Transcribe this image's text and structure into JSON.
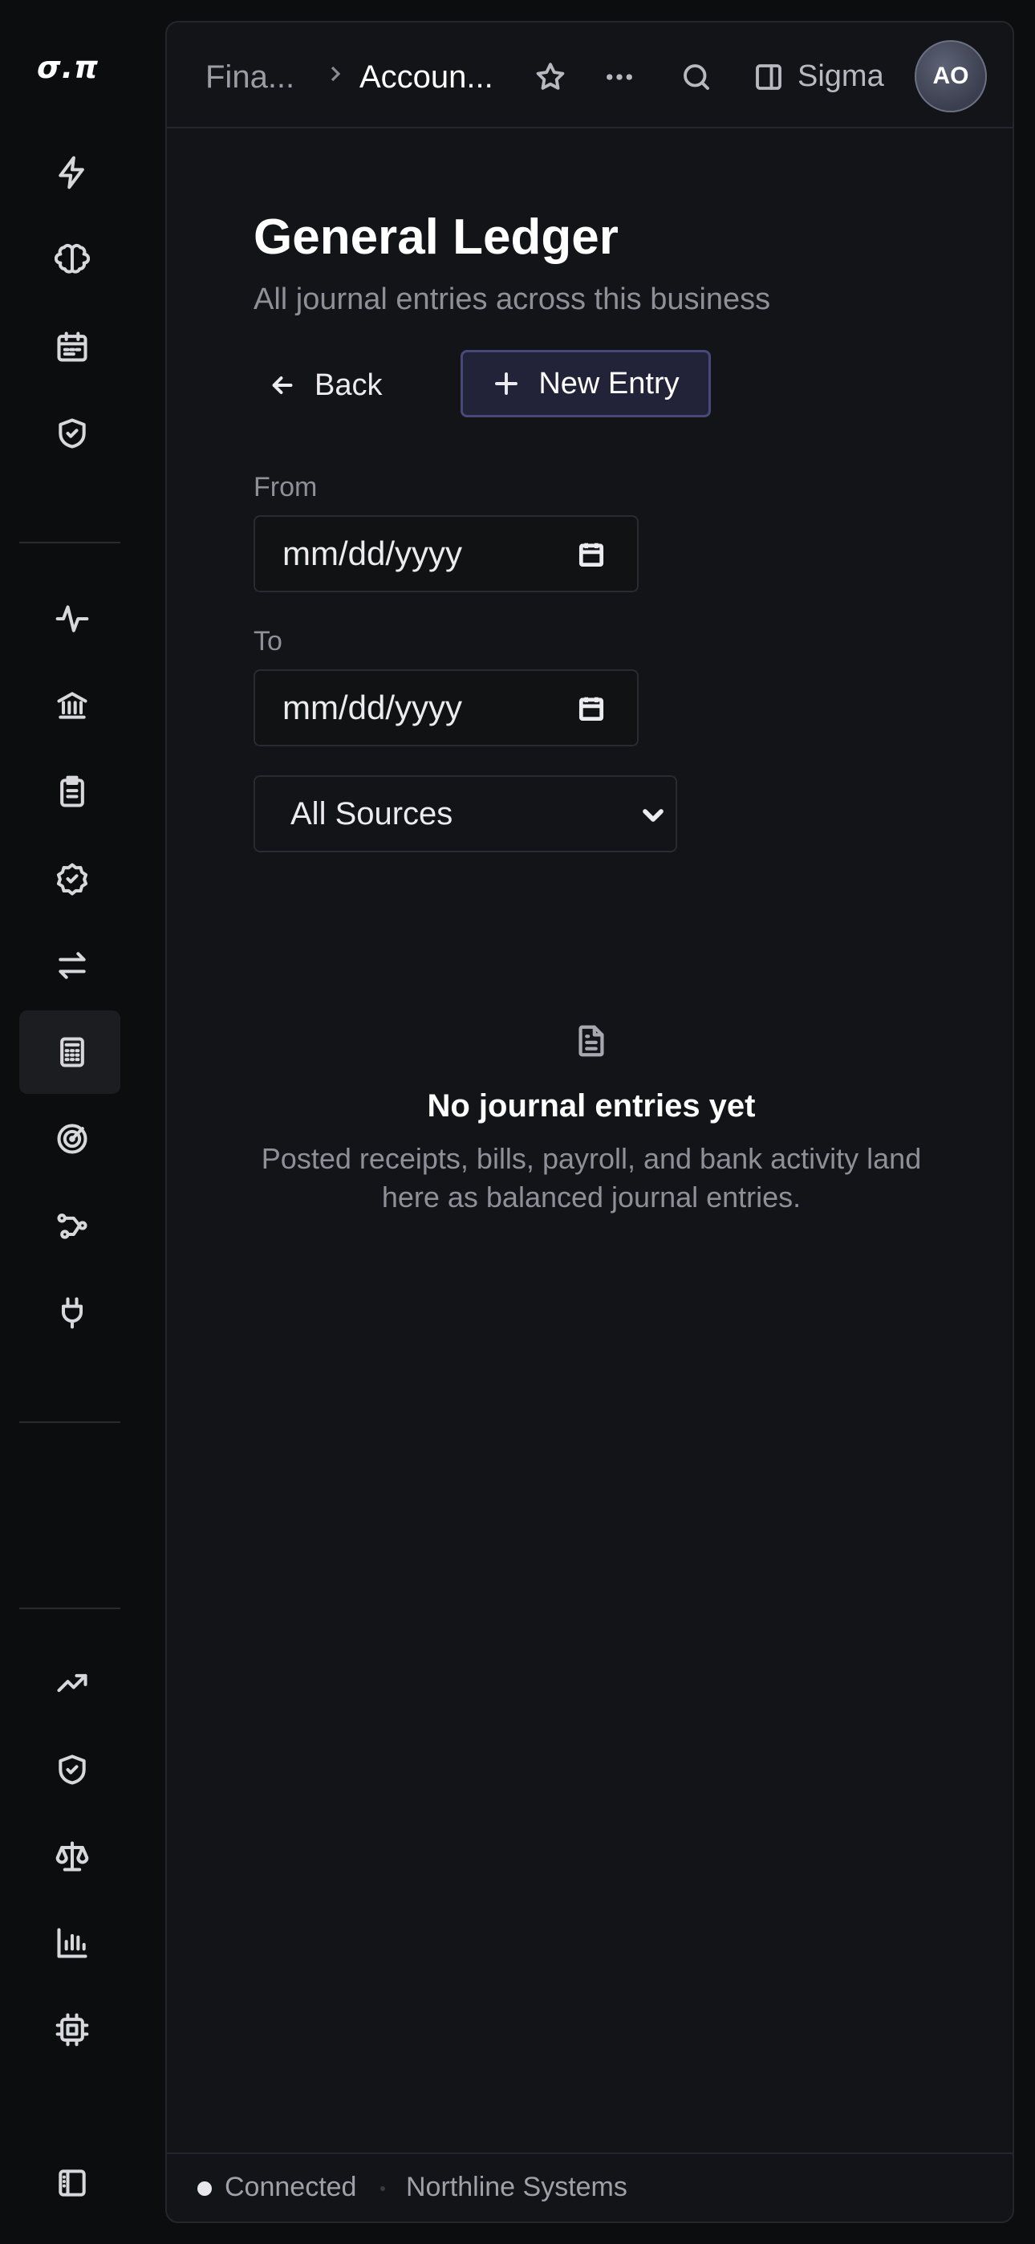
{
  "app": {
    "logo": "σ.π"
  },
  "rail": {
    "group1": [
      "lightning-icon",
      "brain-icon",
      "calendar-icon",
      "shield-check-icon"
    ],
    "group2": [
      "activity-icon",
      "bank-icon",
      "clipboard-icon",
      "badge-check-icon",
      "transfer-icon",
      "calculator-icon",
      "target-icon",
      "workflow-icon",
      "plug-icon"
    ],
    "group3": [
      "trending-up-icon",
      "shield-check-icon",
      "scale-icon",
      "bar-chart-icon",
      "chip-icon"
    ],
    "bottom": [
      "sidebar-toggle-icon"
    ],
    "active": "calculator-icon"
  },
  "header": {
    "breadcrumb": [
      "Fina...",
      "Accoun..."
    ],
    "workspace_label": "Sigma",
    "avatar_initials": "AO"
  },
  "page": {
    "title": "General Ledger",
    "subtitle": "All journal entries across this business",
    "back_label": "Back",
    "new_entry_label": "New Entry"
  },
  "filters": {
    "from_label": "From",
    "from_value": "mm/dd/yyyy",
    "to_label": "To",
    "to_value": "mm/dd/yyyy",
    "source_selected": "All Sources"
  },
  "empty_state": {
    "icon": "document-icon",
    "title": "No journal entries yet",
    "description": "Posted receipts, bills, payroll, and bank activity land here as balanced journal entries."
  },
  "status": {
    "connection": "Connected",
    "company": "Northline Systems"
  },
  "colors": {
    "background": "#0c0d0f",
    "panel": "#131417",
    "accent_button": "#222339",
    "accent_border": "#46497a"
  }
}
